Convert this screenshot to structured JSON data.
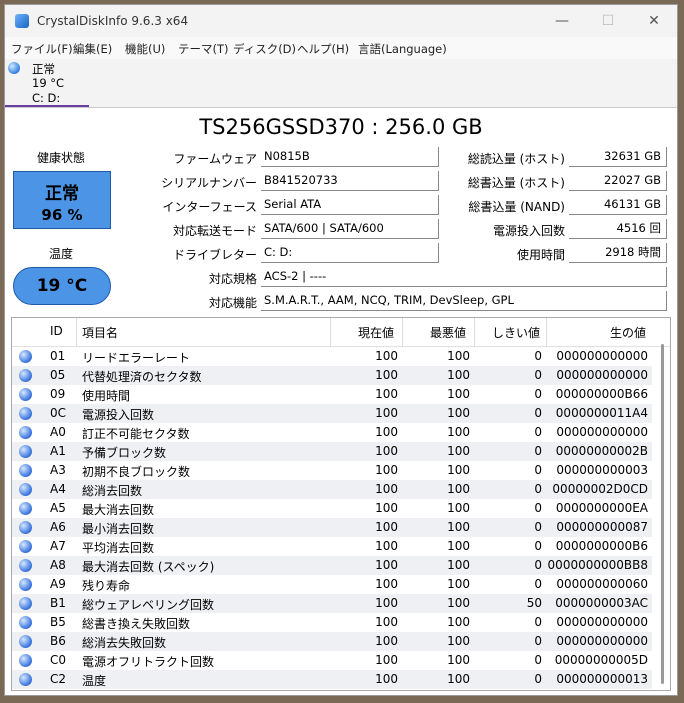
{
  "window": {
    "title": "CrystalDiskInfo 9.6.3 x64",
    "minimize": "—",
    "maximize": "☐",
    "close": "✕"
  },
  "menu": [
    "ファイル(F)",
    "編集(E)",
    "機能(U)",
    "テーマ(T)",
    "ディスク(D)",
    "ヘルプ(H)",
    "言語(Language)"
  ],
  "drive_tab": {
    "status": "正常",
    "temp": "19 °C",
    "letters": "C: D:"
  },
  "model": "TS256GSSD370 : 256.0 GB",
  "health": {
    "label": "健康状態",
    "status": "正常",
    "percent": "96 %"
  },
  "temperature": {
    "label": "温度",
    "value": "19 °C"
  },
  "info_left": [
    {
      "label": "ファームウェア",
      "value": "N0815B"
    },
    {
      "label": "シリアルナンバー",
      "value": "B841520733"
    },
    {
      "label": "インターフェース",
      "value": "Serial ATA"
    },
    {
      "label": "対応転送モード",
      "value": "SATA/600 | SATA/600"
    },
    {
      "label": "ドライブレター",
      "value": "C: D:"
    }
  ],
  "info_right": [
    {
      "label": "総読込量 (ホスト)",
      "value": "32631 GB"
    },
    {
      "label": "総書込量 (ホスト)",
      "value": "22027 GB"
    },
    {
      "label": "総書込量 (NAND)",
      "value": "46131 GB"
    },
    {
      "label": "電源投入回数",
      "value": "4516 回"
    },
    {
      "label": "使用時間",
      "value": "2918 時間"
    }
  ],
  "standard": {
    "label": "対応規格",
    "value": "ACS-2 | ----"
  },
  "features": {
    "label": "対応機能",
    "value": "S.M.A.R.T., AAM, NCQ, TRIM, DevSleep, GPL"
  },
  "table": {
    "headers": [
      "ID",
      "項目名",
      "現在値",
      "最悪値",
      "しきい値",
      "生の値"
    ],
    "rows": [
      {
        "id": "01",
        "name": "リードエラーレート",
        "cur": "100",
        "worst": "100",
        "thr": "0",
        "raw": "000000000000"
      },
      {
        "id": "05",
        "name": "代替処理済のセクタ数",
        "cur": "100",
        "worst": "100",
        "thr": "0",
        "raw": "000000000000"
      },
      {
        "id": "09",
        "name": "使用時間",
        "cur": "100",
        "worst": "100",
        "thr": "0",
        "raw": "000000000B66"
      },
      {
        "id": "0C",
        "name": "電源投入回数",
        "cur": "100",
        "worst": "100",
        "thr": "0",
        "raw": "0000000011A4"
      },
      {
        "id": "A0",
        "name": "訂正不可能セクタ数",
        "cur": "100",
        "worst": "100",
        "thr": "0",
        "raw": "000000000000"
      },
      {
        "id": "A1",
        "name": "予備ブロック数",
        "cur": "100",
        "worst": "100",
        "thr": "0",
        "raw": "00000000002B"
      },
      {
        "id": "A3",
        "name": "初期不良ブロック数",
        "cur": "100",
        "worst": "100",
        "thr": "0",
        "raw": "000000000003"
      },
      {
        "id": "A4",
        "name": "総消去回数",
        "cur": "100",
        "worst": "100",
        "thr": "0",
        "raw": "00000002D0CD"
      },
      {
        "id": "A5",
        "name": "最大消去回数",
        "cur": "100",
        "worst": "100",
        "thr": "0",
        "raw": "0000000000EA"
      },
      {
        "id": "A6",
        "name": "最小消去回数",
        "cur": "100",
        "worst": "100",
        "thr": "0",
        "raw": "000000000087"
      },
      {
        "id": "A7",
        "name": "平均消去回数",
        "cur": "100",
        "worst": "100",
        "thr": "0",
        "raw": "0000000000B6"
      },
      {
        "id": "A8",
        "name": "最大消去回数 (スペック)",
        "cur": "100",
        "worst": "100",
        "thr": "0",
        "raw": "0000000000BB8"
      },
      {
        "id": "A9",
        "name": "残り寿命",
        "cur": "100",
        "worst": "100",
        "thr": "0",
        "raw": "000000000060"
      },
      {
        "id": "B1",
        "name": "総ウェアレベリング回数",
        "cur": "100",
        "worst": "100",
        "thr": "50",
        "raw": "0000000003AC"
      },
      {
        "id": "B5",
        "name": "総書き換え失敗回数",
        "cur": "100",
        "worst": "100",
        "thr": "0",
        "raw": "000000000000"
      },
      {
        "id": "B6",
        "name": "総消去失敗回数",
        "cur": "100",
        "worst": "100",
        "thr": "0",
        "raw": "000000000000"
      },
      {
        "id": "C0",
        "name": "電源オフリトラクト回数",
        "cur": "100",
        "worst": "100",
        "thr": "0",
        "raw": "00000000005D"
      },
      {
        "id": "C2",
        "name": "温度",
        "cur": "100",
        "worst": "100",
        "thr": "0",
        "raw": "000000000013"
      }
    ]
  }
}
